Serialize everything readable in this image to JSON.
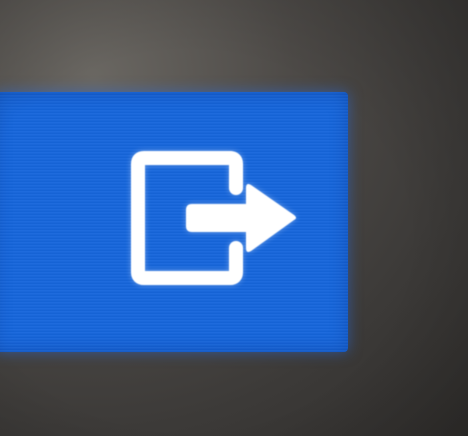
{
  "button": {
    "icon": "logout-icon",
    "accent_color": "#1666dc",
    "icon_color": "#ffffff"
  },
  "background_color": "#3a3836"
}
